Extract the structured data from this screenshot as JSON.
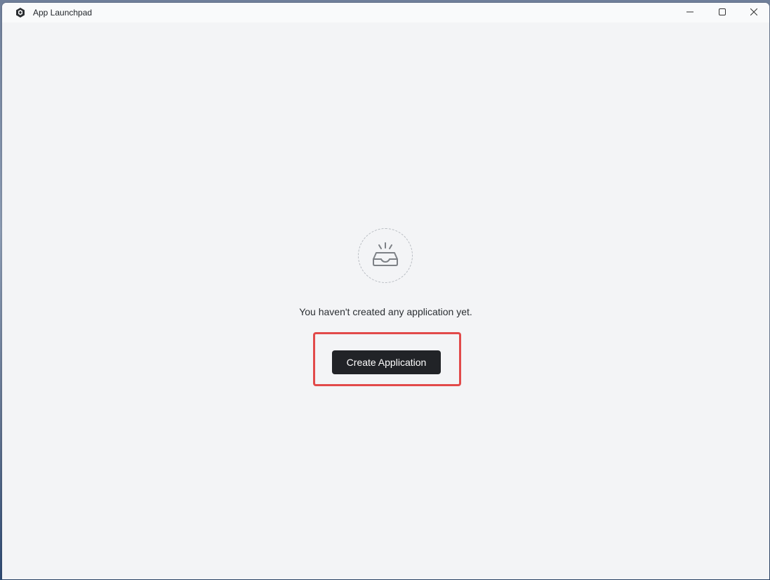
{
  "window": {
    "title": "App Launchpad",
    "controls": {
      "minimize_icon": "minimize-icon",
      "maximize_icon": "maximize-icon",
      "close_icon": "close-icon"
    }
  },
  "empty_state": {
    "icon": "inbox-icon",
    "message": "You haven't created any application yet.",
    "button_label": "Create Application"
  },
  "colors": {
    "button_bg": "#212327",
    "highlight_border": "#e24a4a",
    "content_bg": "#f3f4f6"
  }
}
